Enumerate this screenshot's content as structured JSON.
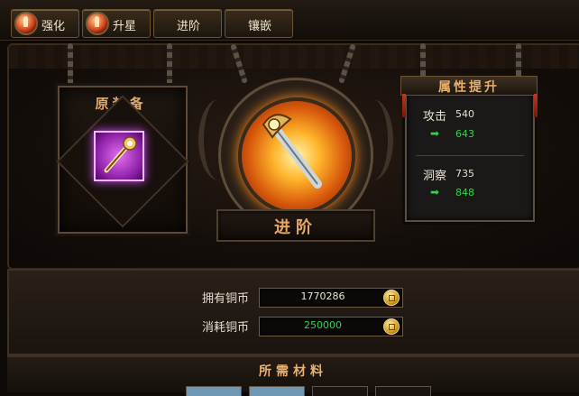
{
  "tabs": [
    {
      "label": "强化",
      "has_icon": true
    },
    {
      "label": "升星",
      "has_icon": true
    },
    {
      "label": "进阶",
      "has_icon": false
    },
    {
      "label": "镶嵌",
      "has_icon": false
    }
  ],
  "original_equipment": {
    "title": "原装备"
  },
  "advance": {
    "label": "进阶"
  },
  "attribute_panel": {
    "title": "属性提升",
    "stats": [
      {
        "name": "攻击",
        "value": "540",
        "new_value": "643"
      },
      {
        "name": "洞察",
        "value": "735",
        "new_value": "848"
      }
    ]
  },
  "coins": {
    "owned_label": "拥有铜币",
    "owned_value": "1770286",
    "cost_label": "消耗铜币",
    "cost_value": "250000"
  },
  "materials": {
    "title": "所需材料"
  },
  "colors": {
    "accent_title": "#e6a764",
    "increase_green": "#33d24a",
    "item_quality_purple": "#d452ff"
  },
  "icons": {
    "tab": "flame-orb-icon",
    "arrow": "right-arrow-icon",
    "coin": "copper-coin-icon",
    "weapon": "weapon-icon"
  }
}
